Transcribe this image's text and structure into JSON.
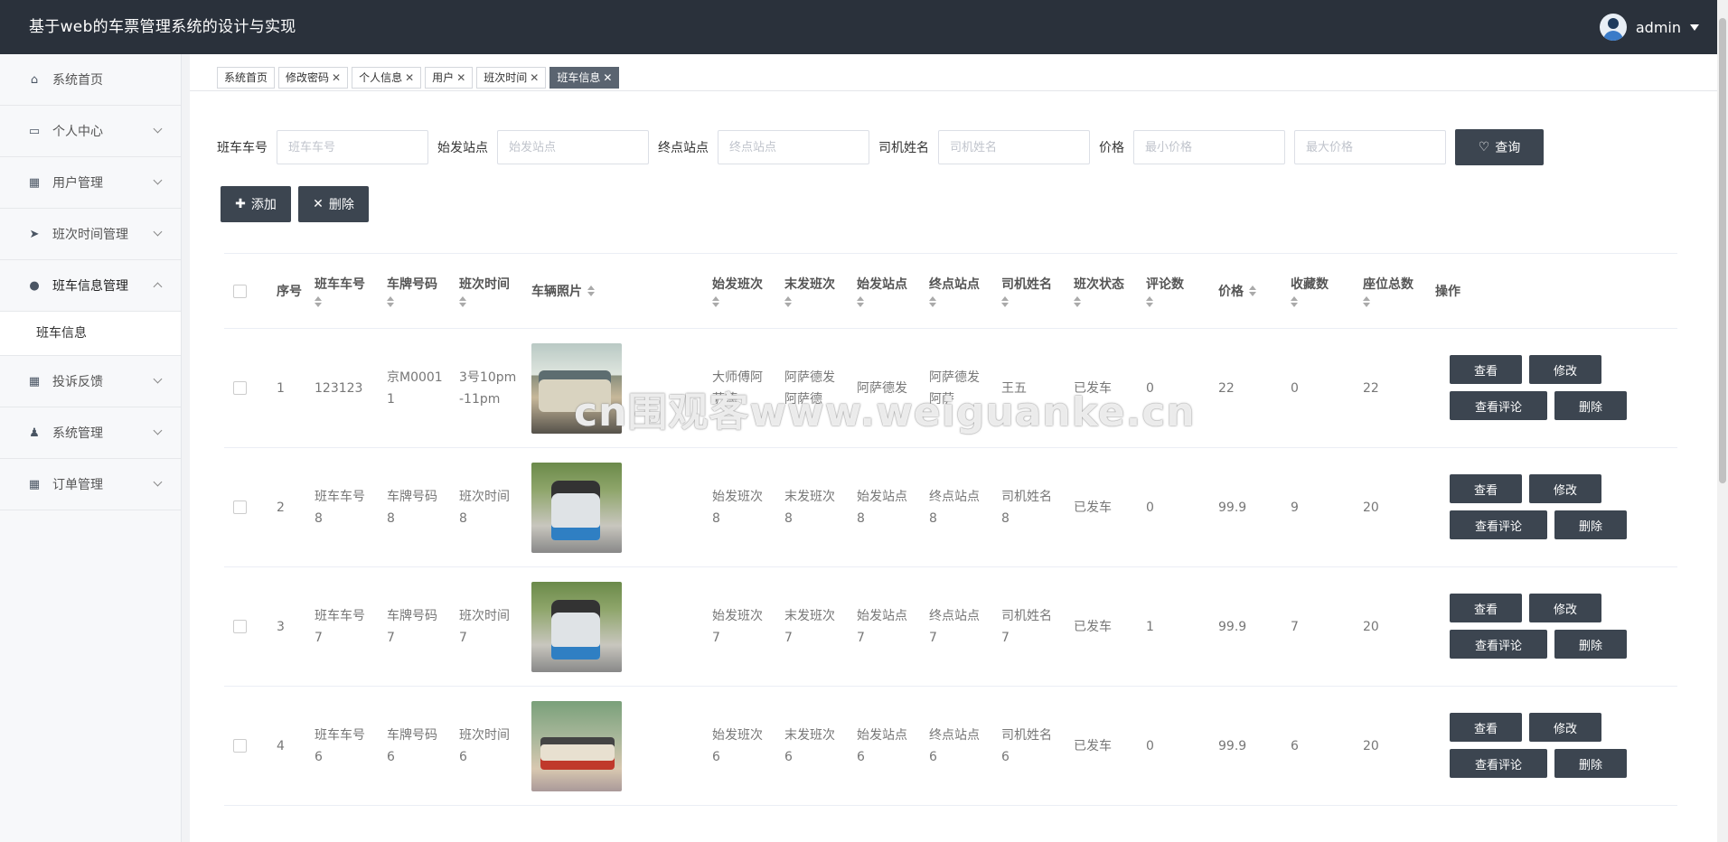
{
  "app": {
    "title": "基于web的车票管理系统的设计与实现",
    "user": "admin"
  },
  "sidebar": {
    "items": [
      {
        "label": "系统首页",
        "icon": "home-icon"
      },
      {
        "label": "个人中心",
        "icon": "card-icon"
      },
      {
        "label": "用户管理",
        "icon": "grid-icon"
      },
      {
        "label": "班次时间管理",
        "icon": "send-icon"
      },
      {
        "label": "班车信息管理",
        "icon": "bulb-icon"
      },
      {
        "label": "投诉反馈",
        "icon": "grid-icon"
      },
      {
        "label": "系统管理",
        "icon": "user-icon"
      },
      {
        "label": "订单管理",
        "icon": "grid-icon"
      }
    ],
    "sub_item": "班车信息"
  },
  "tabs": [
    "系统首页",
    "修改密码",
    "个人信息",
    "用户",
    "班次时间",
    "班车信息"
  ],
  "filters": {
    "labels": [
      "班车车号",
      "始发站点",
      "终点站点",
      "司机姓名",
      "价格"
    ],
    "placeholders": [
      "班车车号",
      "始发站点",
      "终点站点",
      "司机姓名",
      "最小价格",
      "最大价格"
    ],
    "query": "查询"
  },
  "toolbar": {
    "add": "添加",
    "delete": "删除"
  },
  "table": {
    "headers": [
      "序号",
      "班车车号",
      "车牌号码",
      "班次时间",
      "车辆照片",
      "始发班次",
      "末发班次",
      "始发站点",
      "终点站点",
      "司机姓名",
      "班次状态",
      "评论数",
      "价格",
      "收藏数",
      "座位总数",
      "操作"
    ],
    "rows": [
      [
        "1",
        "123123",
        "京M00011",
        "3号10pm-11pm",
        "",
        "大师傅阿萨德",
        "阿萨德发阿萨德",
        "阿萨德发",
        "阿萨德发阿萨",
        "王五",
        "已发车",
        "0",
        "22",
        "0",
        "22"
      ],
      [
        "2",
        "班车车号8",
        "车牌号码8",
        "班次时间8",
        "",
        "始发班次8",
        "末发班次8",
        "始发站点8",
        "终点站点8",
        "司机姓名8",
        "已发车",
        "0",
        "99.9",
        "9",
        "20"
      ],
      [
        "3",
        "班车车号7",
        "车牌号码7",
        "班次时间7",
        "",
        "始发班次7",
        "末发班次7",
        "始发站点7",
        "终点站点7",
        "司机姓名7",
        "已发车",
        "1",
        "99.9",
        "7",
        "20"
      ],
      [
        "4",
        "班车车号6",
        "车牌号码6",
        "班次时间6",
        "",
        "始发班次6",
        "末发班次6",
        "始发站点6",
        "终点站点6",
        "司机姓名6",
        "已发车",
        "0",
        "99.9",
        "6",
        "20"
      ]
    ],
    "row_actions": [
      "查看",
      "修改",
      "查看评论",
      "删除"
    ]
  },
  "watermark": "cn围观客www.weiguanke.cn"
}
